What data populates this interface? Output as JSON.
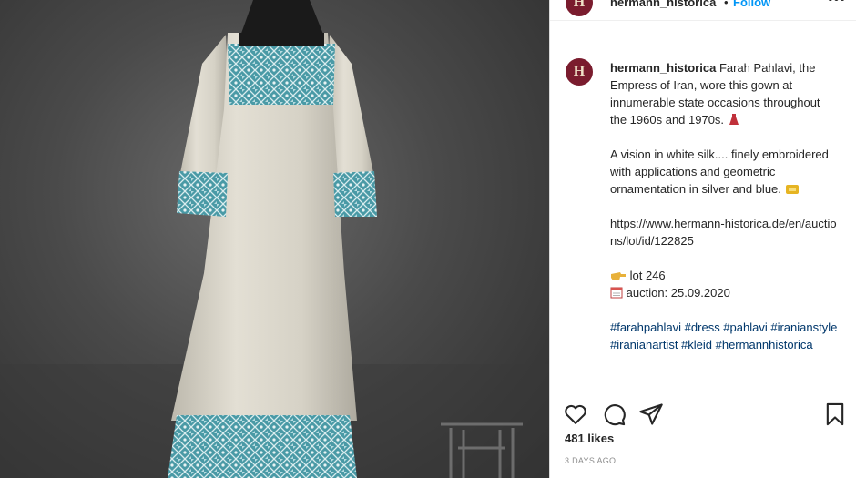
{
  "post": {
    "username": "hermann_historica",
    "separator": "•",
    "follow_label": "Follow",
    "more_label": "•••",
    "avatar_letter": "H",
    "caption": {
      "username": "hermann_historica",
      "line1": "Farah Pahlavi, the Empress of Iran, wore this gown at innumerable state occasions throughout the 1960s and 1970s.",
      "line2": "A vision in white silk.... finely embroidered with applications and geometric ornamentation in silver and blue.",
      "link": "https://www.hermann-historica.de/en/auctions/lot/id/122825",
      "lot": "lot 246",
      "auction": "auction: 25.09.2020",
      "hashtags": "#farahpahlavi #dress #pahlavi #iranianstyle #iranianartist #kleid #hermannhistorica"
    },
    "likes": "481 likes",
    "time_ago": "3 DAYS AGO"
  },
  "icons": {
    "like": "heart-icon",
    "comment": "comment-icon",
    "share": "paper-plane-icon",
    "save": "bookmark-icon",
    "lot": "pointing-hand-icon",
    "auction": "calendar-icon"
  },
  "colors": {
    "follow": "#0095f6",
    "avatar_bg": "#7a1c2e",
    "hashtag": "#00376b",
    "embroidery": "#4a9aa6",
    "dress": "#dcd8cc"
  }
}
